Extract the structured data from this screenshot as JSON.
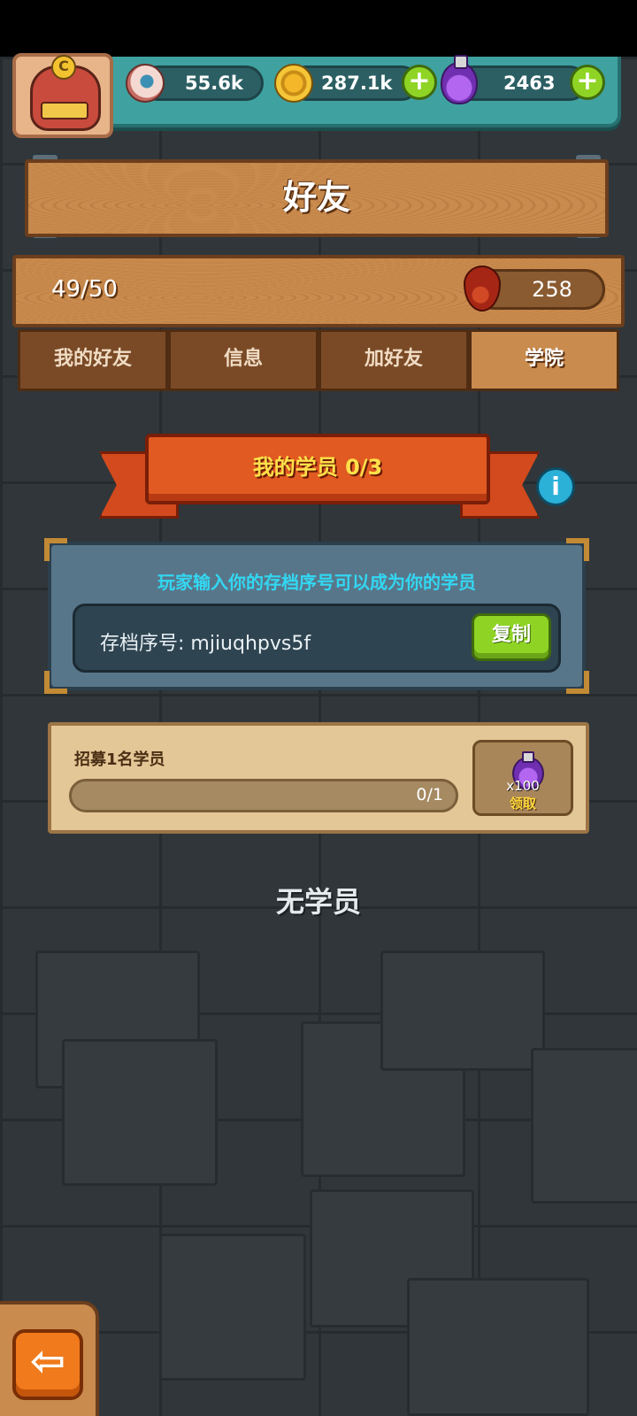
{
  "resources": {
    "eyes": "55.6k",
    "coins": "287.1k",
    "potions": "2463"
  },
  "avatar": {
    "badge": "C"
  },
  "title": "好友",
  "friends": {
    "count": "49/50",
    "blood": "258"
  },
  "tabs": [
    {
      "label": "我的好友",
      "active": false
    },
    {
      "label": "信息",
      "active": false
    },
    {
      "label": "加好友",
      "active": false
    },
    {
      "label": "学院",
      "active": true
    }
  ],
  "academy": {
    "banner": "我的学员 0/3",
    "info_icon": "i",
    "instruction": "玩家输入你的存档序号可以成为你的学员",
    "save_code": "存档序号: mjiuqhpvs5f",
    "copy_label": "复制"
  },
  "task": {
    "label": "招募1名学员",
    "progress_text": "0/1",
    "progress": 0,
    "reward_qty": "x100",
    "claim_label": "领取"
  },
  "empty_message": "无学员",
  "back_arrow": "⇦",
  "plus_symbol": "+"
}
